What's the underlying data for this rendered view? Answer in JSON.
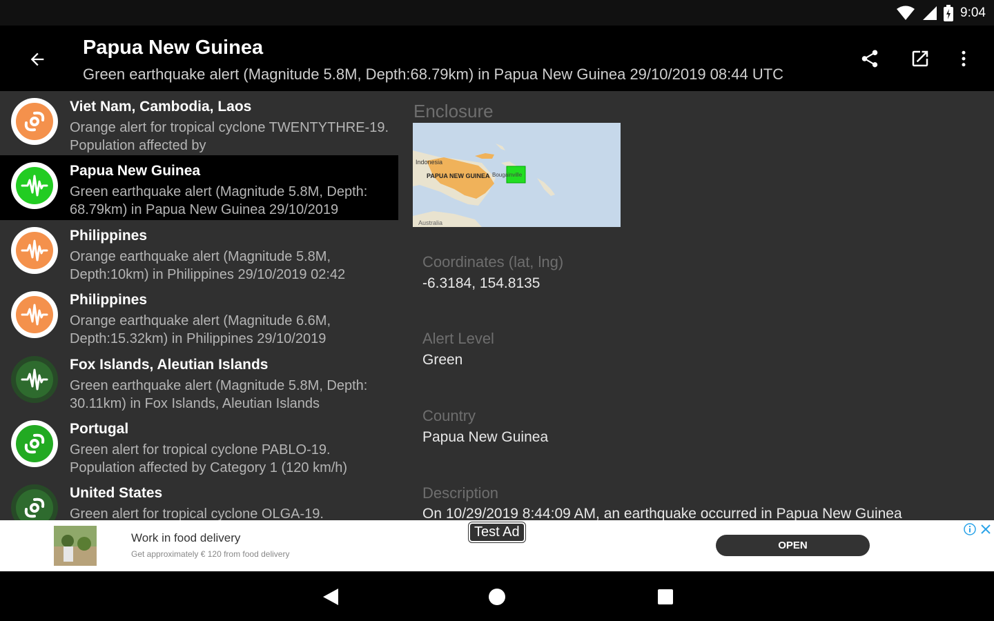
{
  "status": {
    "time": "9:04"
  },
  "appbar": {
    "title": "Papua New Guinea",
    "subtitle": "Green earthquake alert (Magnitude 5.8M, Depth:68.79km) in Papua New Guinea 29/10/2019 08:44 UTC"
  },
  "list": [
    {
      "title": "Viet Nam, Cambodia, Laos",
      "desc": "Orange alert for tropical cyclone TWENTYTHRE-19. Population affected by",
      "type": "cyclone-icon",
      "color": "#f4914c"
    },
    {
      "title": "Papua New Guinea",
      "desc": "Green earthquake alert (Magnitude 5.8M, Depth: 68.79km) in Papua New Guinea 29/10/2019",
      "type": "earthquake-icon",
      "color": "#22cc22",
      "selected": true
    },
    {
      "title": "Philippines",
      "desc": "Orange earthquake alert (Magnitude 5.8M, Depth:10km) in Philippines 29/10/2019 02:42",
      "type": "earthquake-icon",
      "color": "#f4914c"
    },
    {
      "title": "Philippines",
      "desc": "Orange earthquake alert (Magnitude 6.6M, Depth:15.32km) in Philippines 29/10/2019",
      "type": "earthquake-icon",
      "color": "#f4914c"
    },
    {
      "title": "Fox Islands, Aleutian Islands",
      "desc": "Green earthquake alert (Magnitude 5.8M, Depth: 30.11km) in Fox Islands, Aleutian Islands",
      "type": "earthquake-icon",
      "color": "#2e6b2e"
    },
    {
      "title": "Portugal",
      "desc": "Green alert for tropical cyclone PABLO-19. Population affected by Category 1 (120 km/h)",
      "type": "cyclone-icon",
      "color": "#22aa22"
    },
    {
      "title": "United States",
      "desc": "Green alert for tropical cyclone OLGA-19.",
      "type": "cyclone-icon",
      "color": "#2e6b2e"
    }
  ],
  "detail": {
    "enclosure_label": "Enclosure",
    "map": {
      "label_indonesia": "Indonesia",
      "label_png": "PAPUA NEW GUINEA",
      "label_bougainville": "Bougainville",
      "label_australia": "Australia"
    },
    "coordinates_label": "Coordinates (lat, lng)",
    "coordinates_value": "-6.3184, 154.8135",
    "alert_level_label": "Alert Level",
    "alert_level_value": "Green",
    "country_label": "Country",
    "country_value": "Papua New Guinea",
    "description_label": "Description",
    "description_value": "On 10/29/2019 8:44:09 AM, an earthquake occurred in Papua New Guinea"
  },
  "ad": {
    "title": "Work in food delivery",
    "subtitle": "Get approximately € 120 from food delivery",
    "label": "Test Ad",
    "open_label": "OPEN"
  }
}
